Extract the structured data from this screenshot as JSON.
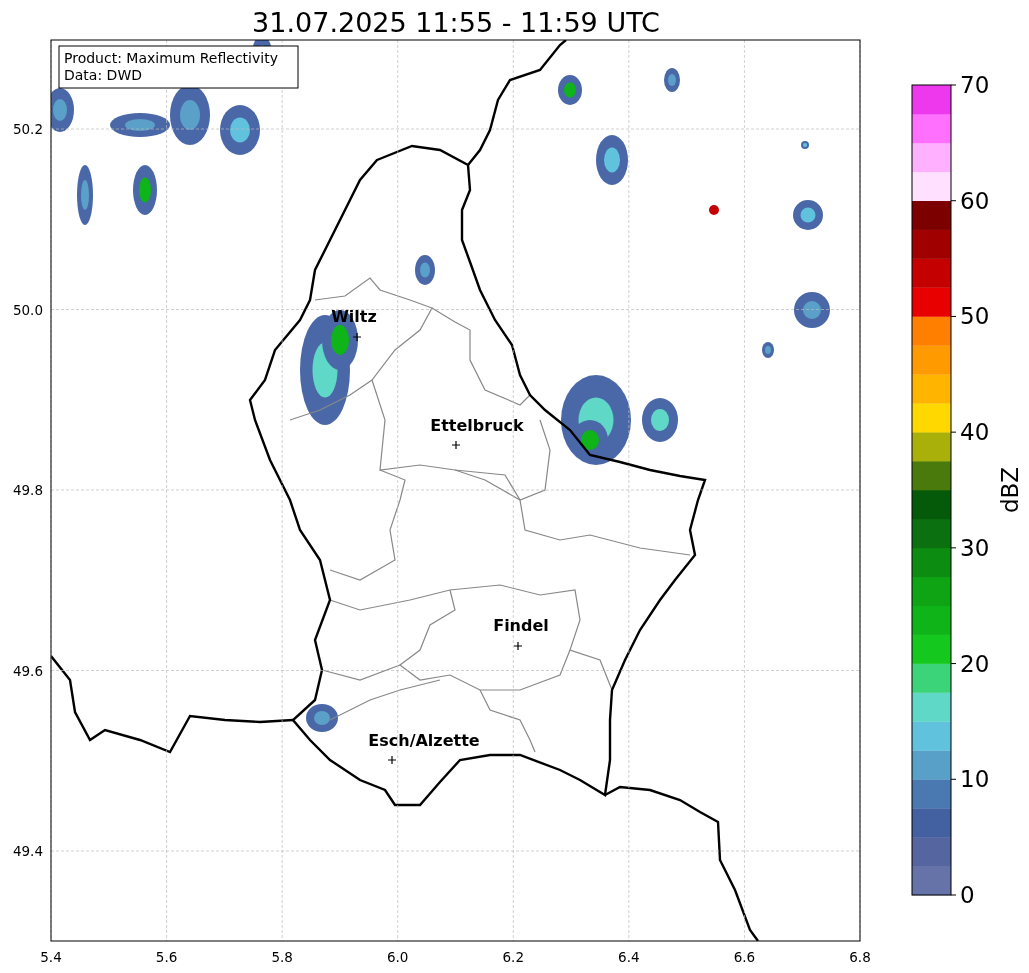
{
  "title": "31.07.2025 11:55 - 11:59 UTC",
  "info_box": [
    "Product: Maximum Reflectivity",
    "Data: DWD"
  ],
  "map": {
    "xticks": [
      "5.4",
      "5.6",
      "5.8",
      "6.0",
      "6.2",
      "6.4",
      "6.6",
      "6.8"
    ],
    "yticks": [
      "50.2",
      "50.0",
      "49.8",
      "49.6",
      "49.4"
    ],
    "cities": [
      {
        "name": "Wiltz"
      },
      {
        "name": "Ettelbruck"
      },
      {
        "name": "Findel"
      },
      {
        "name": "Esch/Alzette"
      }
    ]
  },
  "colorbar": {
    "label": "dBZ",
    "ticks": [
      "70",
      "60",
      "50",
      "40",
      "30",
      "20",
      "10",
      "0"
    ],
    "bins": [
      {
        "color": "#6673a8"
      },
      {
        "color": "#55659f"
      },
      {
        "color": "#4360a0"
      },
      {
        "color": "#4a78b0"
      },
      {
        "color": "#58a0c8"
      },
      {
        "color": "#60c2dc"
      },
      {
        "color": "#60d8c8"
      },
      {
        "color": "#3cd478"
      },
      {
        "color": "#14c81e"
      },
      {
        "color": "#0eb418"
      },
      {
        "color": "#0ea414"
      },
      {
        "color": "#0c8c10"
      },
      {
        "color": "#0a7010"
      },
      {
        "color": "#055a0a"
      },
      {
        "color": "#4a7a0c"
      },
      {
        "color": "#aab00a"
      },
      {
        "color": "#ffd800"
      },
      {
        "color": "#ffb400"
      },
      {
        "color": "#ff9a00"
      },
      {
        "color": "#ff7f00"
      },
      {
        "color": "#e80000"
      },
      {
        "color": "#c40000"
      },
      {
        "color": "#a00000"
      },
      {
        "color": "#7c0000"
      },
      {
        "color": "#ffe0ff"
      },
      {
        "color": "#ffb0ff"
      },
      {
        "color": "#ff70ff"
      },
      {
        "color": "#ee38ee"
      }
    ]
  }
}
